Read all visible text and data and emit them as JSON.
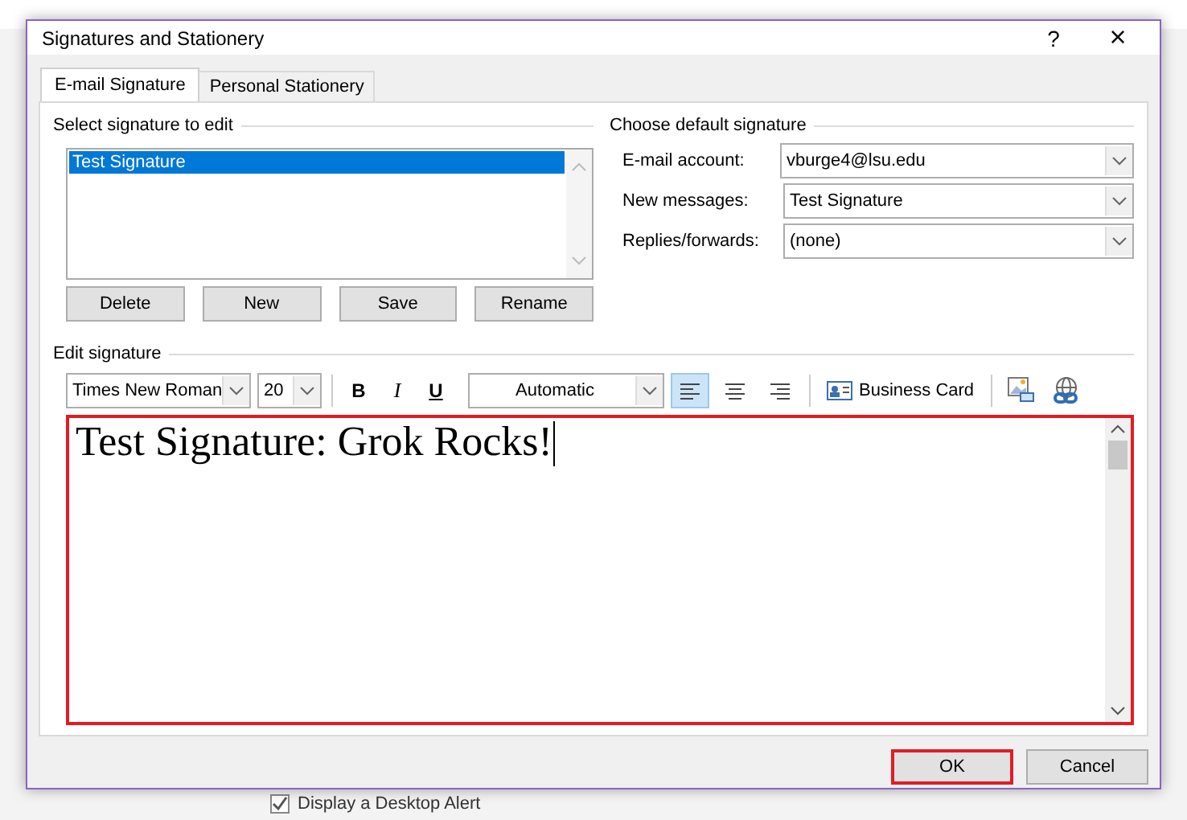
{
  "window": {
    "title": "Signatures and Stationery",
    "help": "?",
    "close": "×"
  },
  "tabs": [
    {
      "label": "E-mail Signature",
      "selected": true
    },
    {
      "label": "Personal Stationery",
      "selected": false
    }
  ],
  "select_signature": {
    "heading": "Select signature to edit",
    "items": [
      {
        "label": "Test Signature",
        "selected": true
      }
    ],
    "buttons": [
      "Delete",
      "New",
      "Save",
      "Rename"
    ]
  },
  "default_signature": {
    "heading": "Choose default signature",
    "fields": [
      {
        "label": "E-mail account:",
        "value": "vburge4@lsu.edu"
      },
      {
        "label": "New messages:",
        "value": "Test Signature"
      },
      {
        "label": "Replies/forwards:",
        "value": "(none)"
      }
    ]
  },
  "edit_signature": {
    "heading": "Edit signature",
    "font": "Times New Roman",
    "size": "20",
    "bold": "B",
    "italic": "I",
    "underline": "U",
    "font_color": "Automatic",
    "alignments": [
      {
        "kind": "left",
        "selected": true
      },
      {
        "kind": "center",
        "selected": false
      },
      {
        "kind": "right",
        "selected": false
      }
    ],
    "business_card": "Business Card",
    "text": "Test Signature: Grok Rocks!",
    "highlighted": true
  },
  "buttons": [
    {
      "label": "OK",
      "highlighted": true
    },
    {
      "label": "Cancel",
      "highlighted": false
    }
  ],
  "background": {
    "checkbox": {
      "label": "Display a Desktop Alert",
      "checked": true
    }
  }
}
